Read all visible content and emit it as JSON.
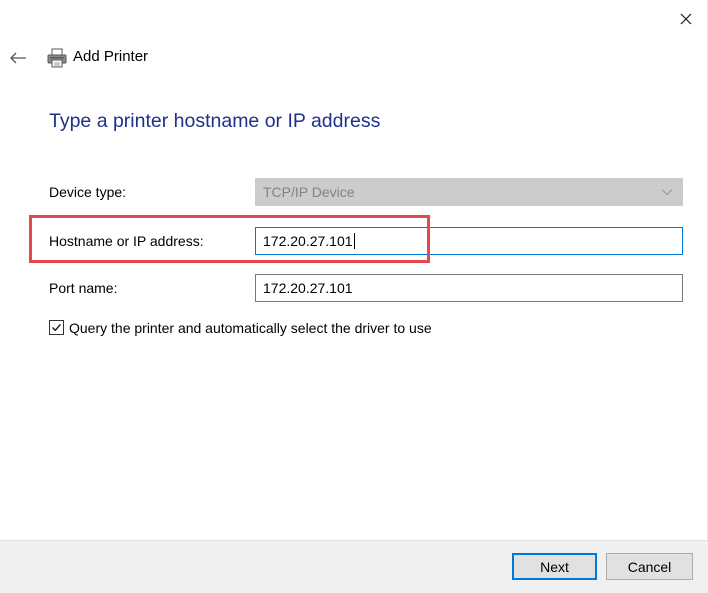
{
  "window": {
    "title": "Add Printer",
    "close_icon": "close-icon",
    "back_icon": "back-arrow-icon",
    "printer_icon": "printer-icon"
  },
  "page": {
    "heading": "Type a printer hostname or IP address"
  },
  "form": {
    "device_type": {
      "label": "Device type:",
      "value": "TCP/IP Device",
      "disabled": true
    },
    "hostname": {
      "label": "Hostname or IP address:",
      "value": "172.20.27.101"
    },
    "port_name": {
      "label": "Port name:",
      "value": "172.20.27.101"
    },
    "query_checkbox": {
      "label": "Query the printer and automatically select the driver to use",
      "checked": true
    }
  },
  "footer": {
    "next_label": "Next",
    "cancel_label": "Cancel"
  },
  "colors": {
    "heading": "#1e3287",
    "focus_border": "#0078d7",
    "highlight_box": "#e8474d",
    "disabled_field": "#cccccc",
    "footer_background": "#f0f0f0"
  }
}
